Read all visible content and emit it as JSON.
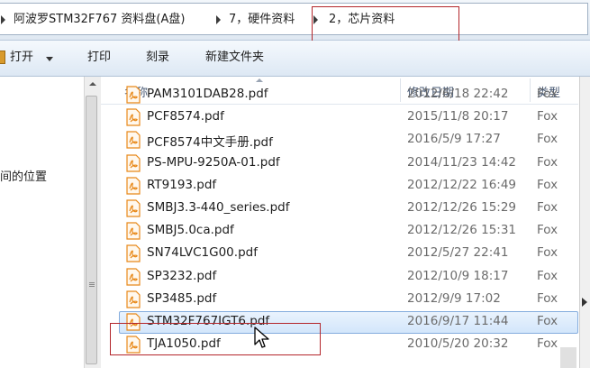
{
  "address_bar": {
    "crumbs": [
      "阿波罗STM32F767 资料盘(A盘)",
      "7，硬件资料",
      "2，芯片资料"
    ]
  },
  "toolbar": {
    "open_label": "打开",
    "print_label": "打印",
    "burn_label": "刻录",
    "new_folder_label": "新建文件夹"
  },
  "nav_pane": {
    "partial_label": "间的位置"
  },
  "columns": {
    "name": "名称",
    "date": "修改日期",
    "type": "类型"
  },
  "files": [
    {
      "name": "PAM3101DAB28.pdf",
      "date": "2012/6/18 22:42",
      "type": "Fox"
    },
    {
      "name": "PCF8574.pdf",
      "date": "2015/11/8 20:17",
      "type": "Fox"
    },
    {
      "name": "PCF8574中文手册.pdf",
      "date": "2016/5/9 17:27",
      "type": "Fox"
    },
    {
      "name": "PS-MPU-9250A-01.pdf",
      "date": "2014/11/23 14:42",
      "type": "Fox"
    },
    {
      "name": "RT9193.pdf",
      "date": "2012/12/22 16:49",
      "type": "Fox"
    },
    {
      "name": "SMBJ3.3-440_series.pdf",
      "date": "2012/12/26 15:29",
      "type": "Fox"
    },
    {
      "name": "SMBJ5.0ca.pdf",
      "date": "2012/12/26 15:31",
      "type": "Fox"
    },
    {
      "name": "SN74LVC1G00.pdf",
      "date": "2012/5/27 22:41",
      "type": "Fox"
    },
    {
      "name": "SP3232.pdf",
      "date": "2012/10/9 18:17",
      "type": "Fox"
    },
    {
      "name": "SP3485.pdf",
      "date": "2012/9/9 17:02",
      "type": "Fox"
    },
    {
      "name": "STM32F767IGT6.pdf",
      "date": "2016/9/17 11:44",
      "type": "Fox",
      "selected": true
    },
    {
      "name": "TJA1050.pdf",
      "date": "2010/5/20 20:32",
      "type": "Fox"
    }
  ],
  "colors": {
    "highlight_box": "#b3262b",
    "selection": "#d3e6fb",
    "pdf_icon": "#e8891a"
  }
}
